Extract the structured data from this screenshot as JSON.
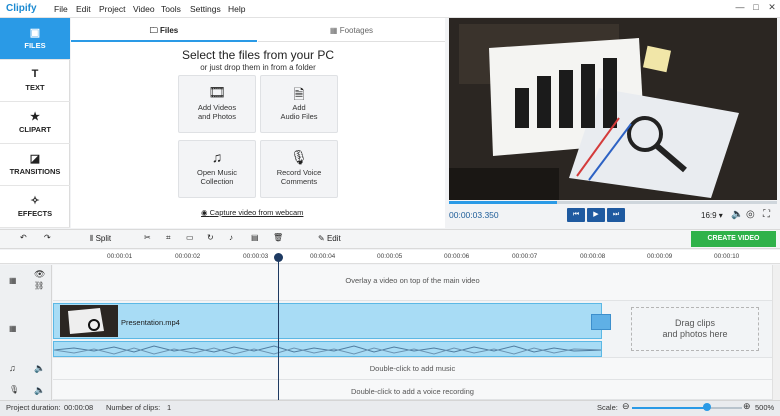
{
  "app": {
    "name": "Clipify"
  },
  "menu": [
    "File",
    "Edit",
    "Project",
    "Video",
    "Tools",
    "Settings",
    "Help"
  ],
  "window_controls": [
    "—",
    "□",
    "✕"
  ],
  "tabs": [
    {
      "label": "FILES",
      "icon": "files-icon"
    },
    {
      "label": "TEXT",
      "icon": "text-icon"
    },
    {
      "label": "CLIPART",
      "icon": "star-icon"
    },
    {
      "label": "TRANSITIONS",
      "icon": "transitions-icon"
    },
    {
      "label": "EFFECTS",
      "icon": "magic-wand-icon"
    }
  ],
  "panel": {
    "tab_files": "Files",
    "tab_footages": "Footages",
    "title": "Select the files from your PC",
    "subtitle": "or just drop them in from a folder",
    "cards": [
      {
        "line1": "Add Videos",
        "line2": "and Photos",
        "icon": "video-photo-icon"
      },
      {
        "line1": "Add",
        "line2": "Audio Files",
        "icon": "audio-file-icon"
      },
      {
        "line1": "Open Music",
        "line2": "Collection",
        "icon": "music-notes-icon"
      },
      {
        "line1": "Record Voice",
        "line2": "Comments",
        "icon": "microphone-icon"
      }
    ],
    "webcam": "Capture video from webcam"
  },
  "player": {
    "timecode": "00:00:03.350",
    "progress": 0.33,
    "ratio": "16:9 ▾"
  },
  "toolbar": {
    "split": "Split",
    "edit": "Edit",
    "create_video": "CREATE VIDEO"
  },
  "ruler": [
    "00:00:01",
    "00:00:02",
    "00:00:03",
    "00:00:04",
    "00:00:05",
    "00:00:06",
    "00:00:07",
    "00:00:08",
    "00:00:09",
    "00:00:10"
  ],
  "timeline": {
    "overlay_hint": "Overlay a video on top of the main video",
    "clip_name": "Presentation.mp4",
    "drag_line1": "Drag clips",
    "drag_line2": "and photos here",
    "music_hint": "Double-click to add music",
    "voice_hint": "Double-click to add a voice recording"
  },
  "status": {
    "duration_label": "Project duration:",
    "duration_value": "00:00:08",
    "clips_label": "Number of clips:",
    "clips_value": "1",
    "scale_label": "Scale:",
    "zoom_value": "500%",
    "zoom_level": 0.68
  },
  "colors": {
    "accent": "#2a9ae6",
    "create_button": "#2fb24a",
    "clip": "#a8dcf5"
  }
}
